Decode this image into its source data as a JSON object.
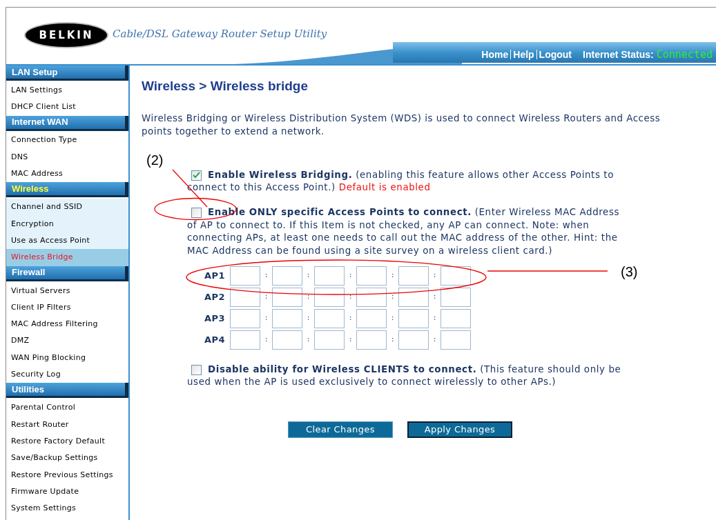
{
  "header": {
    "logo": "BELKIN",
    "tagline": "Cable/DSL Gateway Router Setup Utility",
    "links": [
      "Home",
      "Help",
      "Logout"
    ],
    "status_label": "Internet Status:",
    "status_value": "Connected"
  },
  "sidebar": {
    "sections": [
      {
        "title": "LAN Setup",
        "active": false,
        "items": [
          {
            "label": "LAN Settings",
            "selected": false
          },
          {
            "label": "DHCP Client List",
            "selected": false
          }
        ]
      },
      {
        "title": "Internet WAN",
        "active": false,
        "items": [
          {
            "label": "Connection Type",
            "selected": false
          },
          {
            "label": "DNS",
            "selected": false
          },
          {
            "label": "MAC Address",
            "selected": false
          }
        ]
      },
      {
        "title": "Wireless",
        "active": true,
        "items": [
          {
            "label": "Channel and SSID",
            "selected": false
          },
          {
            "label": "Encryption",
            "selected": false
          },
          {
            "label": "Use as Access Point",
            "selected": false
          },
          {
            "label": "Wireless Bridge",
            "selected": true
          }
        ]
      },
      {
        "title": "Firewall",
        "active": false,
        "items": [
          {
            "label": "Virtual Servers",
            "selected": false
          },
          {
            "label": "Client IP Filters",
            "selected": false
          },
          {
            "label": "MAC Address Filtering",
            "selected": false
          },
          {
            "label": "DMZ",
            "selected": false
          },
          {
            "label": "WAN Ping Blocking",
            "selected": false
          },
          {
            "label": "Security Log",
            "selected": false
          }
        ]
      },
      {
        "title": "Utilities",
        "active": false,
        "items": [
          {
            "label": "Parental Control",
            "selected": false
          },
          {
            "label": "Restart Router",
            "selected": false
          },
          {
            "label": "Restore Factory Default",
            "selected": false
          },
          {
            "label": "Save/Backup Settings",
            "selected": false
          },
          {
            "label": "Restore Previous Settings",
            "selected": false
          },
          {
            "label": "Firmware Update",
            "selected": false
          },
          {
            "label": "System Settings",
            "selected": false
          }
        ]
      }
    ]
  },
  "page": {
    "title": "Wireless > Wireless bridge",
    "description": "Wireless Bridging or Wireless Distribution System (WDS) is used to connect Wireless Routers and Access points together to extend a network.",
    "options": [
      {
        "kind": "checkbox",
        "checked": true,
        "text": "**Enable Wireless Bridging.** (enabling this feature allows other Access Points to connect to this Access Point.)",
        "note": "Default is enabled"
      },
      {
        "kind": "checkbox",
        "checked": false,
        "text": "**Enable ONLY specific Access Points to connect.** (Enter Wireless MAC Address of AP to connect to. If this Item is not checked, any AP can connect. Note: when connecting APs, at least one needs to call out the MAC address of the other. Hint: the MAC Address can be found using a site survey on a wireless client card.)"
      },
      {
        "kind": "mac_table",
        "rows": [
          {
            "label": "AP1"
          },
          {
            "label": "AP2"
          },
          {
            "label": "AP3"
          },
          {
            "label": "AP4"
          }
        ],
        "separator": ":"
      },
      {
        "kind": "checkbox",
        "checked": false,
        "text": "**Disable ability for Wireless CLIENTS to connect.** (This feature should only be used when the AP is used exclusively to connect wirelessly to other APs.)"
      }
    ],
    "buttons": [
      {
        "label": "Clear Changes",
        "kind": "clear"
      },
      {
        "label": "Apply Changes",
        "kind": "apply"
      }
    ]
  },
  "annotations": [
    {
      "label": "(2)"
    },
    {
      "label": "(3)"
    }
  ]
}
